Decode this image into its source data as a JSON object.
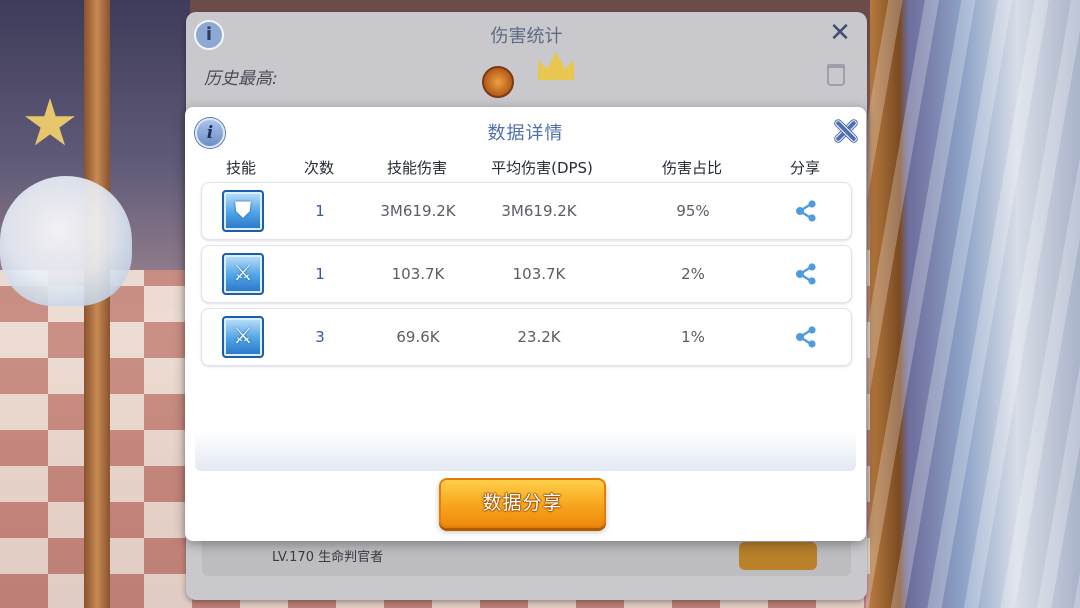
{
  "background_panel": {
    "title": "伤害统计",
    "history_label": "历史最高:",
    "footer_text": "LV.170 生命判官者"
  },
  "dialog": {
    "title": "数据详情",
    "columns": [
      "技能",
      "次数",
      "技能伤害",
      "平均伤害(DPS)",
      "伤害占比",
      "分享"
    ],
    "rows": [
      {
        "skill_icon": "shield-skill-icon",
        "count": "1",
        "skill_damage": "3M619.2K",
        "avg_damage": "3M619.2K",
        "share_percent": "95%"
      },
      {
        "skill_icon": "sword-skill-icon",
        "count": "1",
        "skill_damage": "103.7K",
        "avg_damage": "103.7K",
        "share_percent": "2%"
      },
      {
        "skill_icon": "sword-skill-icon",
        "count": "3",
        "skill_damage": "69.6K",
        "avg_damage": "23.2K",
        "share_percent": "1%"
      }
    ],
    "share_button_label": "数据分享"
  },
  "colors": {
    "accent_blue": "#4f6fae",
    "count_blue": "#3a58a8",
    "button_orange": "#f7a51d",
    "share_icon_blue": "#4f9be0"
  }
}
